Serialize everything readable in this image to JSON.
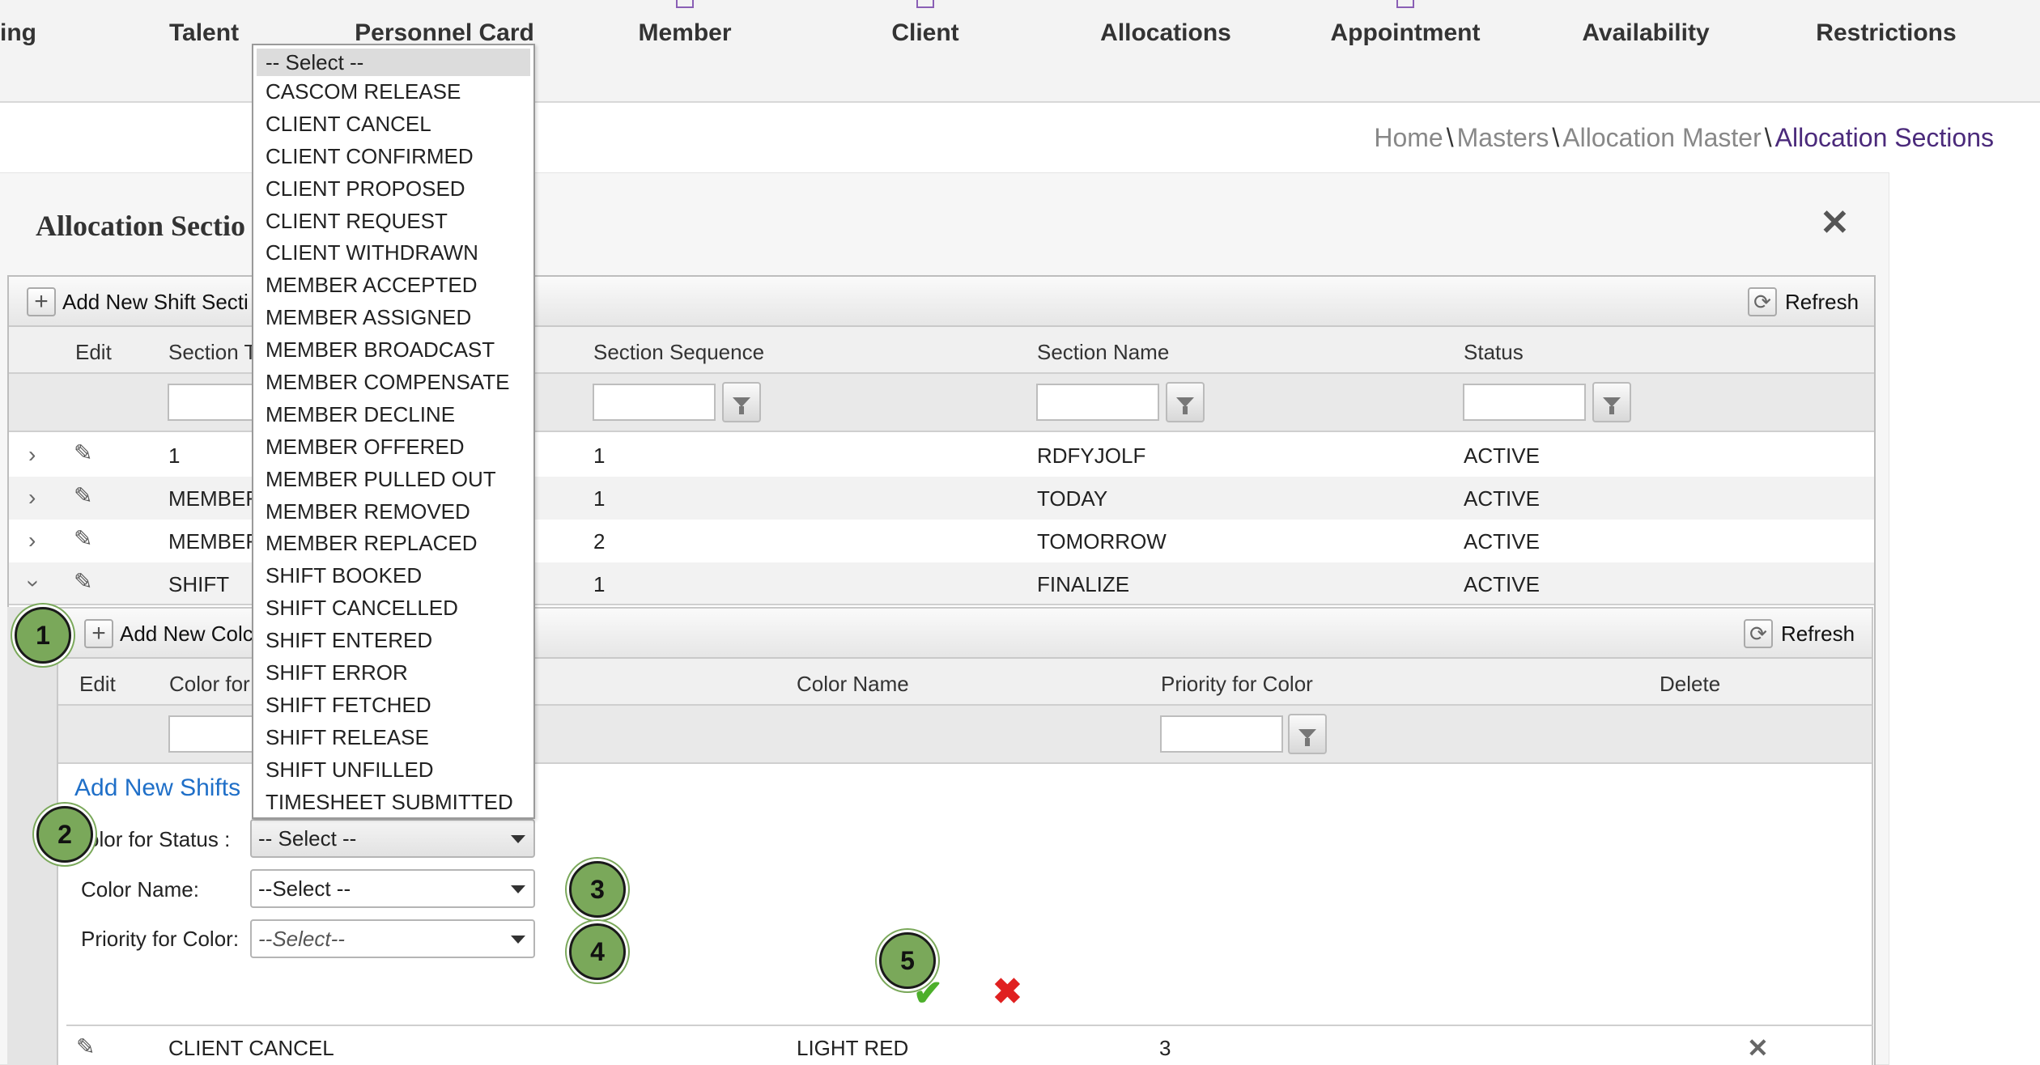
{
  "nav": {
    "items": [
      "ing",
      "Talent",
      "Personnel Card",
      "Member",
      "Client",
      "Allocations",
      "Appointment",
      "Availability",
      "Restrictions"
    ]
  },
  "breadcrumb": {
    "items": [
      "Home",
      "Masters",
      "Allocation Master",
      "Allocation Sections"
    ],
    "separator": "\\"
  },
  "panel": {
    "title": "Allocation Sectio",
    "close_icon": "close-icon"
  },
  "grid": {
    "add_label": "Add New Shift Secti",
    "refresh_label": "Refresh",
    "columns": [
      "Edit",
      "Section T",
      "Section Sequence",
      "Section Name",
      "Status"
    ],
    "rows": [
      {
        "section_type": "1",
        "sequence": "1",
        "name": "RDFYJOLF",
        "status": "ACTIVE",
        "expanded": false
      },
      {
        "section_type": "MEMBEF",
        "sequence": "1",
        "name": "TODAY",
        "status": "ACTIVE",
        "expanded": false
      },
      {
        "section_type": "MEMBEF",
        "sequence": "2",
        "name": "TOMORROW",
        "status": "ACTIVE",
        "expanded": false
      },
      {
        "section_type": "SHIFT",
        "sequence": "1",
        "name": "FINALIZE",
        "status": "ACTIVE",
        "expanded": true
      }
    ]
  },
  "subgrid": {
    "add_label": "Add New Colc",
    "refresh_label": "Refresh",
    "columns": [
      "Edit",
      "Color for",
      "Color Name",
      "Priority for Color",
      "Delete"
    ],
    "form": {
      "title": "Add New Shifts",
      "color_status_label": "olor for Status :",
      "color_status_value": "-- Select --",
      "color_name_label": "Color Name:",
      "color_name_value": "--Select --",
      "priority_label": "Priority for Color:",
      "priority_value": "--Select--"
    },
    "rows": [
      {
        "color_for": "CLIENT CANCEL",
        "color_name": "LIGHT RED",
        "priority": "3"
      }
    ]
  },
  "dropdown": {
    "options": [
      "-- Select --",
      "CASCOM RELEASE",
      "CLIENT CANCEL",
      "CLIENT CONFIRMED",
      "CLIENT PROPOSED",
      "CLIENT REQUEST",
      "CLIENT WITHDRAWN",
      "MEMBER ACCEPTED",
      "MEMBER ASSIGNED",
      "MEMBER BROADCAST",
      "MEMBER COMPENSATE",
      "MEMBER DECLINE",
      "MEMBER OFFERED",
      "MEMBER PULLED OUT",
      "MEMBER REMOVED",
      "MEMBER REPLACED",
      "SHIFT BOOKED",
      "SHIFT CANCELLED",
      "SHIFT ENTERED",
      "SHIFT ERROR",
      "SHIFT FETCHED",
      "SHIFT RELEASE",
      "SHIFT UNFILLED",
      "TIMESHEET SUBMITTED"
    ],
    "selected": "-- Select --"
  },
  "badges": [
    "1",
    "2",
    "3",
    "4",
    "5"
  ],
  "colors": {
    "accent": "#4b2a7b",
    "link": "#1f6fc8",
    "badge": "#7aa85a",
    "ok": "#4caf2a",
    "cancel": "#e02020"
  }
}
